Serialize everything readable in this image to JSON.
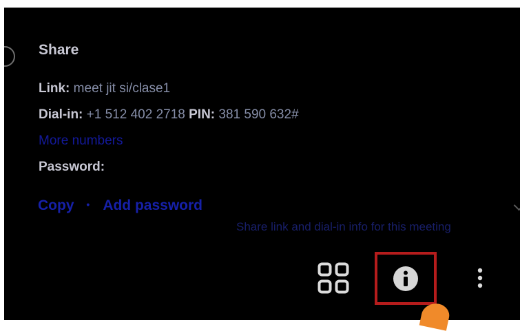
{
  "share": {
    "title": "Share",
    "link_label": "Link:",
    "link_value": "meet jit si/clase1",
    "dialin_label": "Dial-in:",
    "dialin_value": "+1 512 402 2718",
    "pin_label": "PIN:",
    "pin_value": "381 590 632#",
    "more_numbers": "More numbers",
    "password_label": "Password:",
    "copy_label": "Copy",
    "separator": "•",
    "add_password_label": "Add password"
  },
  "tooltip": {
    "text": "Share link and dial-in info for this meeting"
  },
  "toolbar": {
    "tile_view_icon": "tile-view-icon",
    "info_icon": "info-icon",
    "more_icon": "more-vertical-icon",
    "highlight_color": "#b51c1c"
  },
  "colors": {
    "background": "#000000",
    "link_blue": "#1620a8",
    "cursor_orange": "#f08a2a"
  }
}
